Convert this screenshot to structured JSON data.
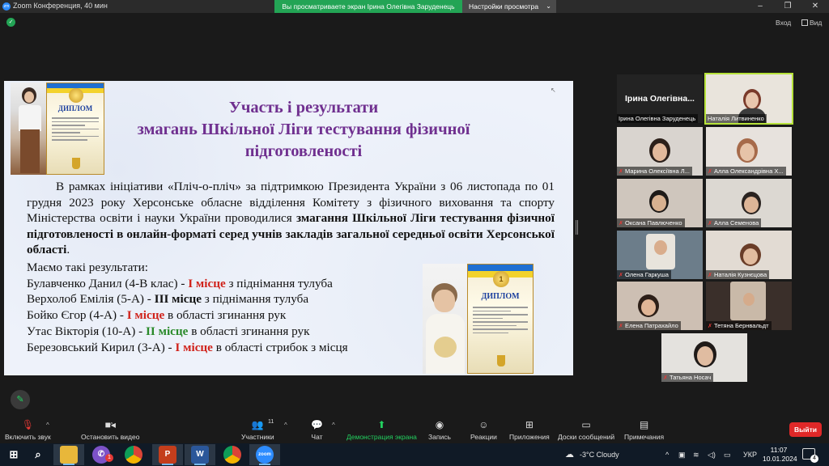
{
  "window": {
    "title": "Zoom Конференция, 40 мин",
    "share_banner": "Вы просматриваете экран Ірина Олегівна Заруденець",
    "view_options": "Настройки просмотра",
    "enter_label": "Вход",
    "view_label": "Вид"
  },
  "slide": {
    "title_lines": [
      "Участь і результати",
      "змагань Шкільної Ліги тестування фізичної",
      "підготовленості"
    ],
    "para_normal_1": "В рамках ініціативи «Пліч-о-пліч» за підтримкою Президента України з 06 листопада по 01 грудня 2023 року Херсонське обласне відділення Комітету з фізичного виховання та спорту Міністерства освіти і науки України проводилися ",
    "para_bold": "змагання Шкільної Ліги тестування фізичної підготовленості в онлайн-форматі серед учнів закладів загальної середньої освіти Херсонської області",
    "para_end": ".",
    "results_intro": "Маємо такі результати:",
    "results": [
      {
        "name": "Булавченко Данил (4-В клас) - ",
        "place": "І місце",
        "color": "red",
        "event": " з піднімання тулуба"
      },
      {
        "name": "Верхолоб Емілія (5-А) - ",
        "place": "ІІІ місце",
        "color": "dark",
        "event": " з піднімання тулуба"
      },
      {
        "name": "Бойко Єгор (4-А) - ",
        "place": "І місце",
        "color": "red",
        "event": " в області згинання рук"
      },
      {
        "name": "Утас Вікторія (10-А) - ",
        "place": "ІІ місце",
        "color": "green",
        "event": " в області згинання рук"
      },
      {
        "name": "Березовський Кирил (3-А) - ",
        "place": "І місце",
        "color": "red",
        "event": " в області стрибок з місця"
      }
    ],
    "diploma_word": "ДИПЛОМ"
  },
  "gallery": {
    "tiles": [
      {
        "name": "Ірина Олегівна Заруденець",
        "big_name": "Ірина Олегівна...",
        "muted": false,
        "active": false,
        "video": false
      },
      {
        "name": "Наталія Литвиненко",
        "muted": false,
        "active": true,
        "video": true
      },
      {
        "name": "Марина Олексіївна Л...",
        "muted": true,
        "active": false,
        "video": true
      },
      {
        "name": "Алла Олександрівна Х...",
        "muted": true,
        "active": false,
        "video": true
      },
      {
        "name": "Оксана Павлюченко",
        "muted": true,
        "active": false,
        "video": true
      },
      {
        "name": "Алла Семенова",
        "muted": true,
        "active": false,
        "video": true
      },
      {
        "name": "Олена Гаркуша",
        "muted": true,
        "active": false,
        "video": true
      },
      {
        "name": "Наталія Кузнєцова",
        "muted": true,
        "active": false,
        "video": true
      },
      {
        "name": "Елена Патрахайло",
        "muted": true,
        "active": false,
        "video": true
      },
      {
        "name": "Тетяна Бернвальдт",
        "muted": true,
        "active": false,
        "video": true
      },
      {
        "name": "Татьяна Носач",
        "muted": true,
        "active": false,
        "video": true
      }
    ]
  },
  "toolbar": {
    "unmute": "Включить звук",
    "start_video": "Остановить видео",
    "participants": "Участники",
    "participants_count": "11",
    "chat": "Чат",
    "share": "Демонстрация экрана",
    "record": "Запись",
    "reactions": "Реакции",
    "apps": "Приложения",
    "whiteboards": "Доски сообщений",
    "notes": "Примечания",
    "leave": "Выйти"
  },
  "taskbar": {
    "weather": "-3°C  Cloudy",
    "lang": "УКР",
    "time": "11:07",
    "date": "10.01.2024",
    "notif_count": "4",
    "viber_badge": "1"
  },
  "colors": {
    "accent_green": "#23a455",
    "title_purple": "#6f2f8f",
    "place_red": "#d0221a",
    "place_green": "#2a8a2a",
    "leave_red": "#e02828"
  }
}
